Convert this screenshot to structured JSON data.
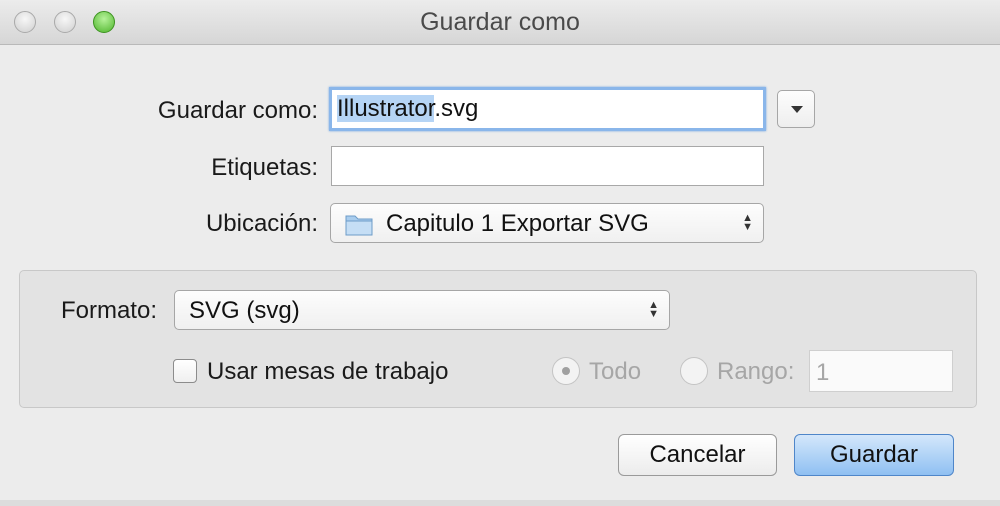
{
  "window": {
    "title": "Guardar como"
  },
  "form": {
    "save_as_label": "Guardar como:",
    "filename_selected": "Illustrator",
    "filename_rest": ".svg",
    "tags_label": "Etiquetas:",
    "tags_value": "",
    "location_label": "Ubicación:",
    "location_value": "Capitulo 1 Exportar SVG"
  },
  "options": {
    "format_label": "Formato:",
    "format_value": "SVG (svg)",
    "artboards_label": "Usar mesas de trabajo",
    "artboards_checked": false,
    "all_label": "Todo",
    "range_label": "Rango:",
    "range_value": "1"
  },
  "buttons": {
    "cancel": "Cancelar",
    "save": "Guardar"
  },
  "colors": {
    "default_button": "#8fc0f2",
    "focus_ring": "#8ab6ea",
    "selection": "#b5d4f5",
    "zoom_button": "#4fb52c"
  }
}
